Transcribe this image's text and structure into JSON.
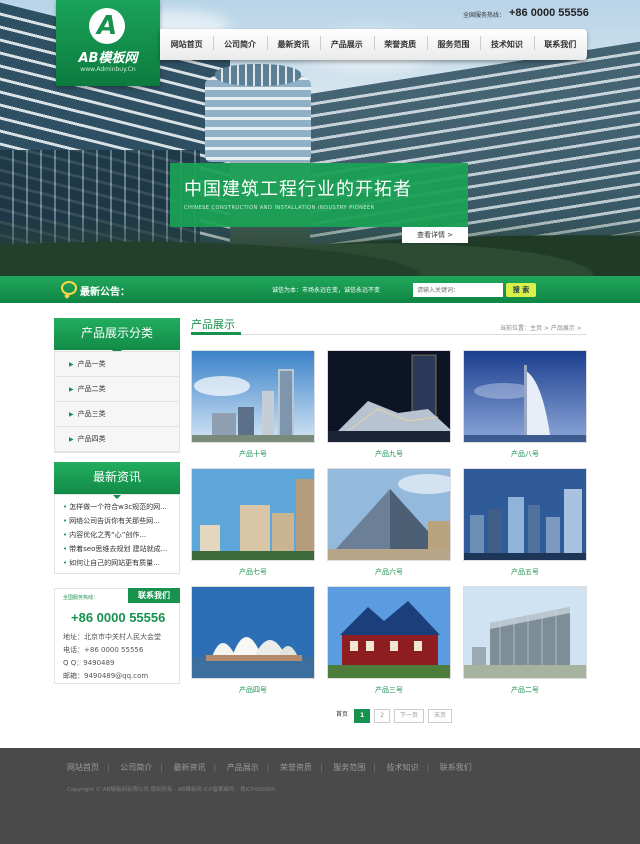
{
  "header": {
    "logo_name": "AB模板网",
    "logo_url": "www.Adminbuy.Cn",
    "hotline_label": "全国服务热线：",
    "hotline_number": "+86 0000 55556"
  },
  "nav": {
    "items": [
      "网站首页",
      "公司简介",
      "最新资讯",
      "产品展示",
      "荣誉资质",
      "服务范围",
      "技术知识",
      "联系我们"
    ]
  },
  "banner": {
    "title": "中国建筑工程行业的开拓者",
    "subtitle": "CHINESE CONSTRUCTION AND INSTALLATION INDUSTRY PIONEER",
    "button_label": "查看详情 >"
  },
  "notice": {
    "label": "最新公告：",
    "text": "诚信为本：市场永远在变，诚信永远不变",
    "search_placeholder": "请输入关键词：",
    "search_button": "搜 索"
  },
  "sidebar": {
    "categories_title": "产品展示分类",
    "categories": [
      "产品一类",
      "产品二类",
      "产品三类",
      "产品四类"
    ],
    "news_title": "最新资讯",
    "news": [
      "怎样做一个符合w3c规范的网...",
      "网络公司告诉你有关那些网...",
      "内容优化之秀“心”创作...",
      "带着seo思维去规划 建站就成...",
      "如何让自己的网站更有质量..."
    ],
    "contact_tab": "联系我们",
    "contact_hot_label": "全国服务热线：",
    "contact_number": "+86 0000 55556",
    "contact_lines": [
      "地址：北京市中关村人民大会堂",
      "电话：+86 0000 55556",
      "Q Q：9490489",
      "邮箱：9490489@qq.com"
    ]
  },
  "main": {
    "title": "产品展示",
    "breadcrumb": "当前位置：主页 > 产品展示 >",
    "products": [
      "产品十号",
      "产品九号",
      "产品八号",
      "产品七号",
      "产品六号",
      "产品五号",
      "产品四号",
      "产品三号",
      "产品二号"
    ]
  },
  "pager": {
    "first": "首页",
    "current": "1",
    "page2": "2",
    "next": "下一页",
    "last": "末页"
  },
  "footer": {
    "nav": [
      "网站首页",
      "公司简介",
      "最新资讯",
      "产品展示",
      "荣誉资质",
      "服务范围",
      "技术知识",
      "联系我们"
    ],
    "copyright": "Copyright © AB模板网有限公司 版权所有 · AB模板网 ICP备案编号：粤ICP000000"
  },
  "colors": {
    "brand_green": "#16924e",
    "footer_bg": "#4a4a4a"
  }
}
